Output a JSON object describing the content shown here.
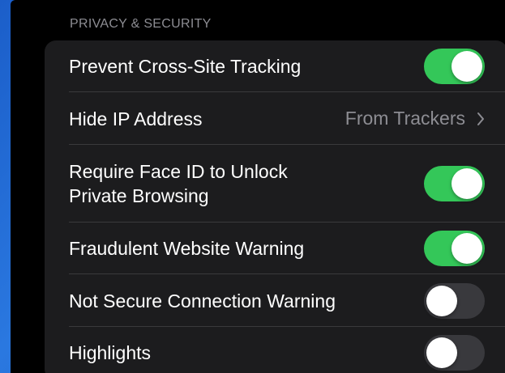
{
  "section": {
    "header": "PRIVACY & SECURITY"
  },
  "rows": [
    {
      "label": "Prevent Cross-Site Tracking",
      "type": "toggle",
      "enabled": true
    },
    {
      "label": "Hide IP Address",
      "type": "detail",
      "value": "From Trackers",
      "icon": "chevron-right-icon"
    },
    {
      "label": "Require Face ID to Unlock\nPrivate Browsing",
      "type": "toggle",
      "enabled": true
    },
    {
      "label": "Fraudulent Website Warning",
      "type": "toggle",
      "enabled": true
    },
    {
      "label": "Not Secure Connection Warning",
      "type": "toggle",
      "enabled": false
    },
    {
      "label": "Highlights",
      "type": "toggle",
      "enabled": false
    }
  ],
  "colors": {
    "toggle_on": "#34c759",
    "toggle_off": "#39393d",
    "group_background": "#1c1c1e",
    "secondary_text": "#8d8d93"
  }
}
